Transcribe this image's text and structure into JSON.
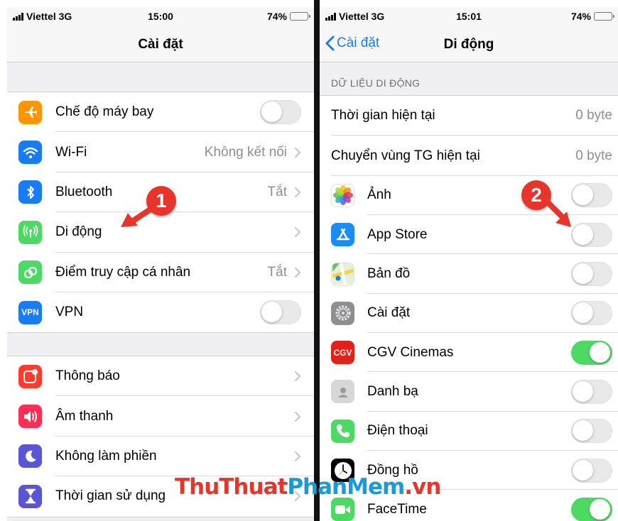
{
  "left_screen": {
    "status": {
      "carrier": "Viettel 3G",
      "time": "15:00",
      "battery": "74%"
    },
    "title": "Cài đặt",
    "group1": [
      {
        "label": "Chế độ máy bay",
        "icon": "airplane-icon",
        "color": "#ff9500",
        "control": "toggle",
        "on": false
      },
      {
        "label": "Wi-Fi",
        "icon": "wifi-icon",
        "color": "#1a7cf5",
        "value": "Không kết nối",
        "control": "chevron"
      },
      {
        "label": "Bluetooth",
        "icon": "bluetooth-icon",
        "color": "#1a7cf5",
        "value": "Tắt",
        "control": "chevron"
      },
      {
        "label": "Di động",
        "icon": "cellular-icon",
        "color": "#4cd964",
        "control": "chevron"
      },
      {
        "label": "Điểm truy cập cá nhân",
        "icon": "hotspot-icon",
        "color": "#4cd964",
        "value": "Tắt",
        "control": "chevron"
      },
      {
        "label": "VPN",
        "icon": "vpn-icon",
        "color": "#1a7cf5",
        "icon_text": "VPN",
        "control": "toggle",
        "on": false
      }
    ],
    "group2": [
      {
        "label": "Thông báo",
        "icon": "notifications-icon",
        "color": "#ff3b30",
        "control": "chevron"
      },
      {
        "label": "Âm thanh",
        "icon": "sound-icon",
        "color": "#ff2d55",
        "control": "chevron"
      },
      {
        "label": "Không làm phiền",
        "icon": "moon-icon",
        "color": "#5856d6",
        "control": "chevron"
      },
      {
        "label": "Thời gian sử dụng",
        "icon": "hourglass-icon",
        "color": "#5856d6",
        "control": "chevron"
      }
    ]
  },
  "right_screen": {
    "status": {
      "carrier": "Viettel 3G",
      "time": "15:01",
      "battery": "74%"
    },
    "back_label": "Cài đặt",
    "title": "Di động",
    "section_header": "DỮ LIỆU DI ĐỘNG",
    "usage": [
      {
        "label": "Thời gian hiện tại",
        "value": "0 byte"
      },
      {
        "label": "Chuyển vùng TG hiện tại",
        "value": "0 byte"
      }
    ],
    "apps": [
      {
        "label": "Ảnh",
        "icon": "photos-icon",
        "on": false
      },
      {
        "label": "App Store",
        "icon": "app-store-icon",
        "on": false
      },
      {
        "label": "Bản đồ",
        "icon": "maps-icon",
        "on": false
      },
      {
        "label": "Cài đặt",
        "icon": "settings-icon",
        "on": false
      },
      {
        "label": "CGV Cinemas",
        "icon": "cgv-icon",
        "on": true,
        "icon_text": "CGV"
      },
      {
        "label": "Danh bạ",
        "icon": "contacts-icon",
        "on": false
      },
      {
        "label": "Điện thoại",
        "icon": "phone-icon",
        "on": false
      },
      {
        "label": "Đồng hồ",
        "icon": "clock-icon",
        "on": false
      },
      {
        "label": "FaceTime",
        "icon": "facetime-icon",
        "on": true
      }
    ]
  },
  "annotations": {
    "step1": "1",
    "step2": "2",
    "accent": "#e8352b"
  },
  "watermark": {
    "part1": "ThuThuat",
    "part2": "PhanMem",
    "part3": ".vn"
  }
}
